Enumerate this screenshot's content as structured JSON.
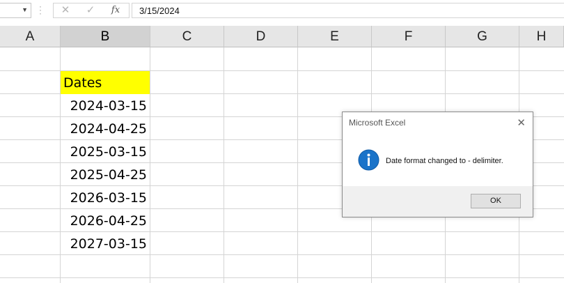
{
  "formula_bar": {
    "cancel_icon": "✕",
    "enter_icon": "✓",
    "fx_label": "fx",
    "value": "3/15/2024"
  },
  "columns": [
    "A",
    "B",
    "C",
    "D",
    "E",
    "F",
    "G",
    "H"
  ],
  "selected_column": "B",
  "cells": {
    "header": "Dates",
    "header_fill": "#ffff00",
    "dates": [
      "2024-03-15",
      "2024-04-25",
      "2025-03-15",
      "2025-04-25",
      "2026-03-15",
      "2026-04-25",
      "2027-03-15"
    ]
  },
  "dialog": {
    "title": "Microsoft Excel",
    "close_icon": "✕",
    "icon": "info-icon",
    "message": "Date format changed to - delimiter.",
    "ok_label": "OK"
  }
}
